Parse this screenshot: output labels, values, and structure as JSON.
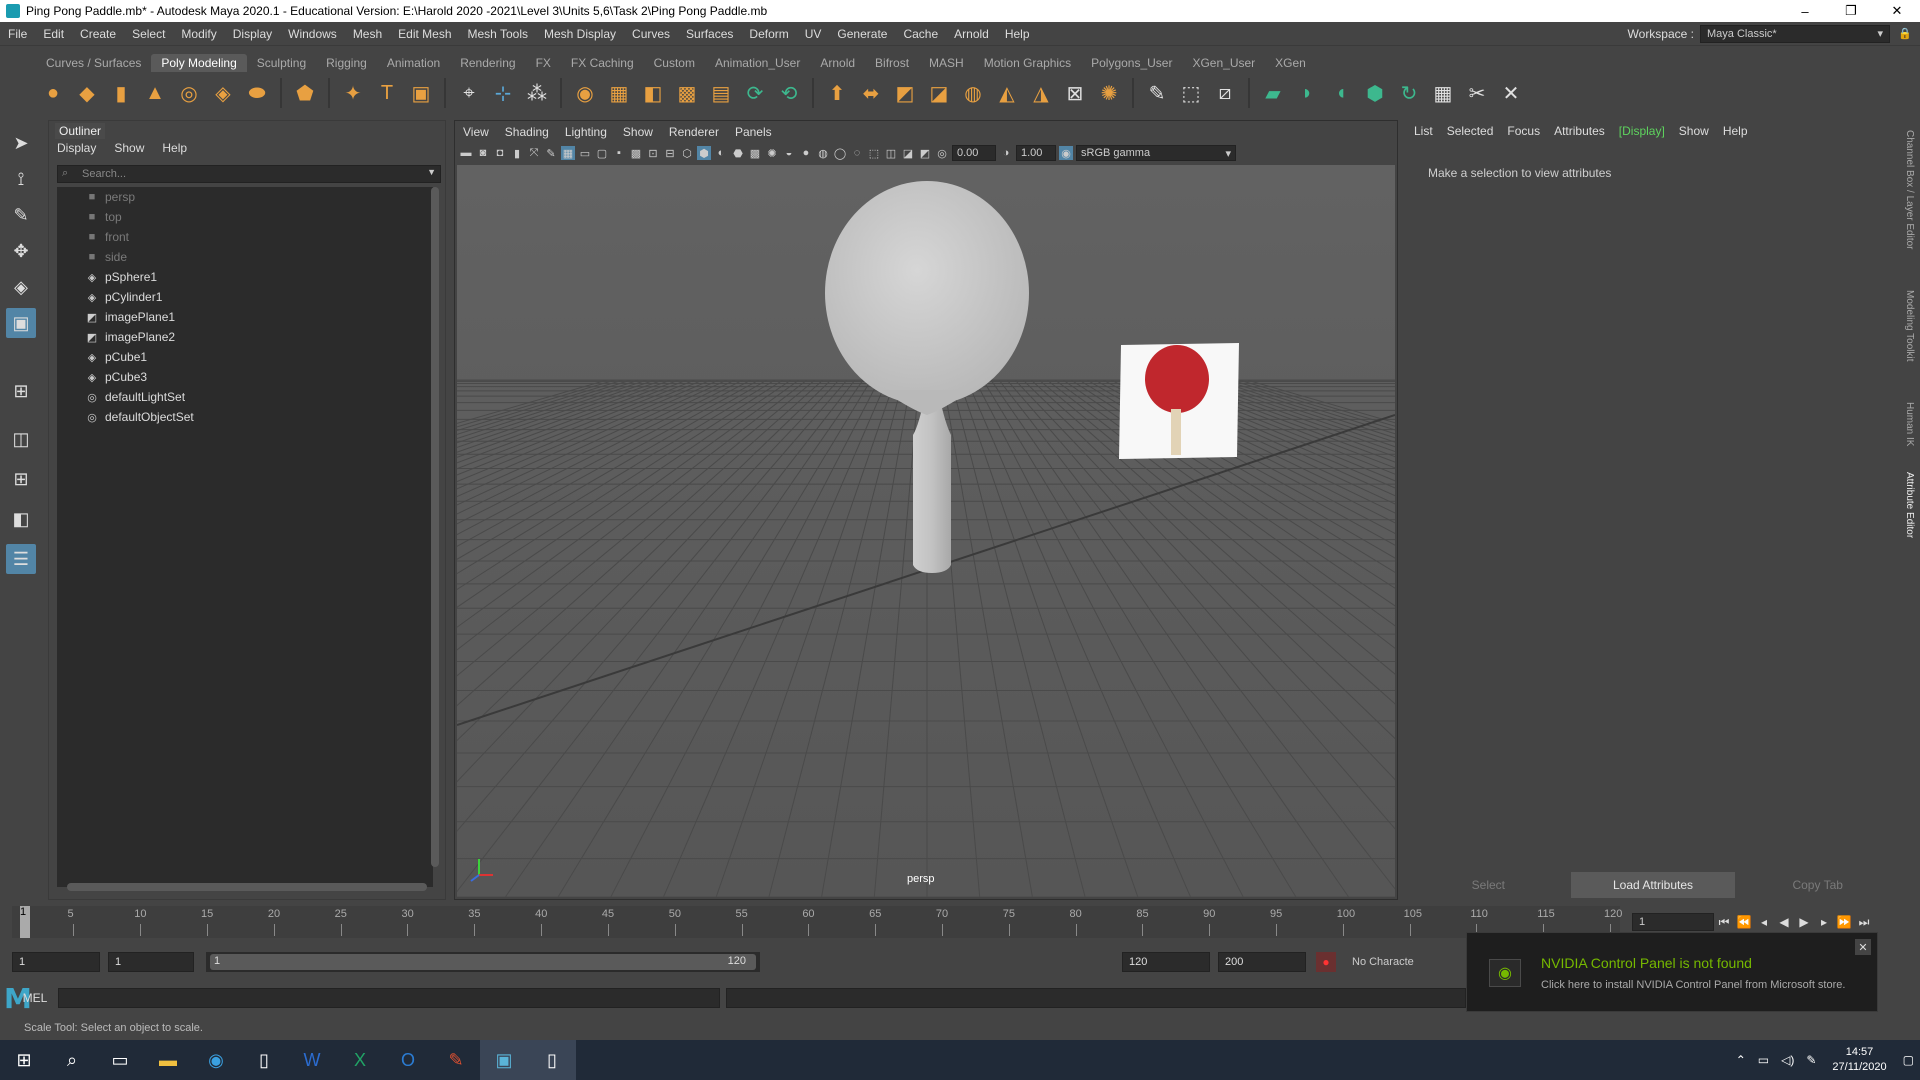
{
  "window": {
    "title": "Ping Pong Paddle.mb* - Autodesk Maya 2020.1 - Educational Version: E:\\Harold 2020 -2021\\Level 3\\Units 5,6\\Task 2\\Ping Pong Paddle.mb",
    "minimize": "–",
    "maximize": "❐",
    "close": "✕"
  },
  "menubar": {
    "items": [
      "File",
      "Edit",
      "Create",
      "Select",
      "Modify",
      "Display",
      "Windows",
      "Mesh",
      "Edit Mesh",
      "Mesh Tools",
      "Mesh Display",
      "Curves",
      "Surfaces",
      "Deform",
      "UV",
      "Generate",
      "Cache",
      "Arnold",
      "Help"
    ],
    "workspace_label": "Workspace :",
    "workspace_value": "Maya Classic*"
  },
  "shelf": {
    "tabs": [
      "Curves / Surfaces",
      "Poly Modeling",
      "Sculpting",
      "Rigging",
      "Animation",
      "Rendering",
      "FX",
      "FX Caching",
      "Custom",
      "Animation_User",
      "Arnold",
      "Bifrost",
      "MASH",
      "Motion Graphics",
      "Polygons_User",
      "XGen_User",
      "XGen"
    ],
    "active_tab": "Poly Modeling"
  },
  "outliner": {
    "title": "Outliner",
    "menus": [
      "Display",
      "Show",
      "Help"
    ],
    "search_placeholder": "Search...",
    "items": [
      {
        "label": "persp",
        "icon": "camera-icon",
        "dim": true
      },
      {
        "label": "top",
        "icon": "camera-icon",
        "dim": true
      },
      {
        "label": "front",
        "icon": "camera-icon",
        "dim": true
      },
      {
        "label": "side",
        "icon": "camera-icon",
        "dim": true
      },
      {
        "label": "pSphere1",
        "icon": "mesh-icon",
        "dim": false
      },
      {
        "label": "pCylinder1",
        "icon": "mesh-icon",
        "dim": false
      },
      {
        "label": "imagePlane1",
        "icon": "image-plane-icon",
        "dim": false
      },
      {
        "label": "imagePlane2",
        "icon": "image-plane-icon",
        "dim": false
      },
      {
        "label": "pCube1",
        "icon": "mesh-icon",
        "dim": false
      },
      {
        "label": "pCube3",
        "icon": "mesh-icon",
        "dim": false
      },
      {
        "label": "defaultLightSet",
        "icon": "set-icon",
        "dim": false
      },
      {
        "label": "defaultObjectSet",
        "icon": "set-icon",
        "dim": false
      }
    ]
  },
  "viewport": {
    "menus": [
      "View",
      "Shading",
      "Lighting",
      "Show",
      "Renderer",
      "Panels"
    ],
    "exposure": "0.00",
    "gamma": "1.00",
    "color_space": "sRGB gamma",
    "camera_label": "persp"
  },
  "attribute_editor": {
    "menus": [
      "List",
      "Selected",
      "Focus",
      "Attributes",
      "[Display]",
      "Show",
      "Help"
    ],
    "hint": "Make a selection to view attributes",
    "buttons": [
      "Select",
      "Load Attributes",
      "Copy Tab"
    ]
  },
  "side_tabs": [
    "Channel Box / Layer Editor",
    "Modeling Toolkit",
    "Human IK",
    "Attribute Editor"
  ],
  "timeline": {
    "ticks": [
      "1",
      "5",
      "10",
      "15",
      "20",
      "25",
      "30",
      "35",
      "40",
      "45",
      "50",
      "55",
      "60",
      "65",
      "70",
      "75",
      "80",
      "85",
      "90",
      "95",
      "100",
      "105",
      "110",
      "115",
      "120"
    ],
    "current_frame": "1"
  },
  "range": {
    "start": "1",
    "playback_start": "1",
    "slider_left": "1",
    "slider_right": "120",
    "playback_end": "120",
    "end": "200",
    "character": "No Characte"
  },
  "mel": {
    "label": "MEL"
  },
  "status": "Scale Tool: Select an object to scale.",
  "notification": {
    "title": "NVIDIA Control Panel is not found",
    "body": "Click here to install NVIDIA Control Panel from Microsoft store."
  },
  "taskbar": {
    "time": "14:57",
    "date": "27/11/2020"
  },
  "colors": {
    "accent": "#5285a6",
    "nvidia_green": "#76b900",
    "paddle_red": "#c0272d"
  }
}
